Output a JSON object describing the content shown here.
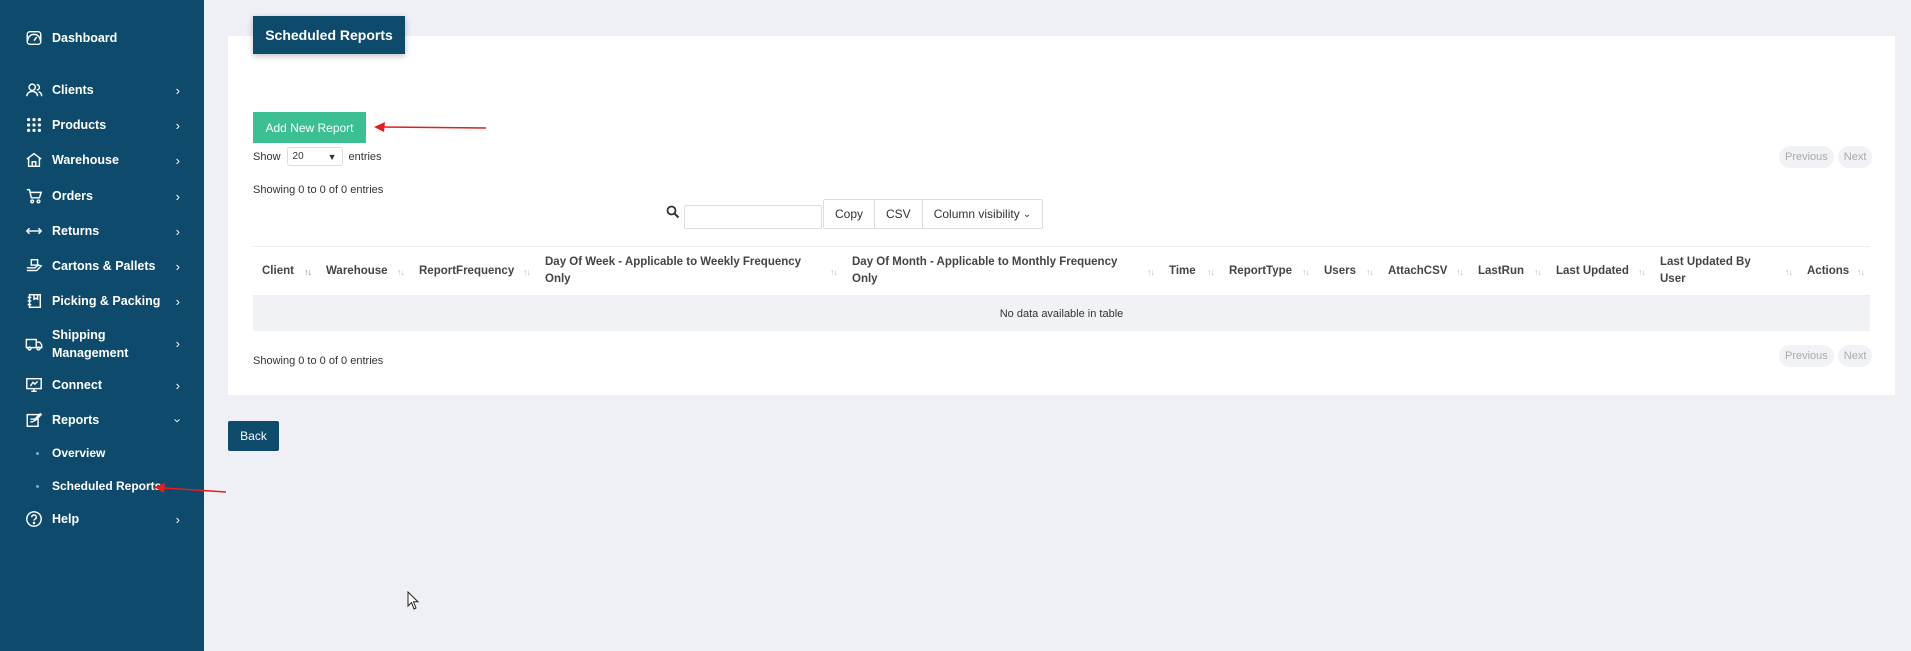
{
  "sidebar": {
    "items": [
      {
        "label": "Dashboard",
        "icon": "dashboard-icon"
      },
      {
        "label": "Clients",
        "icon": "clients-icon"
      },
      {
        "label": "Products",
        "icon": "products-icon"
      },
      {
        "label": "Warehouse",
        "icon": "warehouse-icon"
      },
      {
        "label": "Orders",
        "icon": "orders-icon"
      },
      {
        "label": "Returns",
        "icon": "returns-icon"
      },
      {
        "label": "Cartons & Pallets",
        "icon": "cartons-icon"
      },
      {
        "label": "Picking & Packing",
        "icon": "picking-icon"
      },
      {
        "label": "Shipping",
        "label2": "Management",
        "icon": "shipping-icon"
      },
      {
        "label": "Connect",
        "icon": "connect-icon"
      },
      {
        "label": "Reports",
        "icon": "reports-icon"
      },
      {
        "label": "Help",
        "icon": "help-icon"
      }
    ],
    "reports_sub": [
      {
        "label": "Overview"
      },
      {
        "label": "Scheduled Reports"
      }
    ]
  },
  "main": {
    "title": "Scheduled Reports",
    "add_button": "Add New Report",
    "show_label": "Show",
    "entries_label": "entries",
    "page_length": "20",
    "info_top": "Showing 0 to 0 of 0 entries",
    "info_bottom": "Showing 0 to 0 of 0 entries",
    "pager": {
      "previous": "Previous",
      "next": "Next"
    },
    "buttons": {
      "copy": "Copy",
      "csv": "CSV",
      "colvis": "Column visibility"
    },
    "columns": [
      "Client",
      "Warehouse",
      "ReportFrequency",
      "Day Of Week - Applicable to Weekly Frequency Only",
      "Day Of Month - Applicable to Monthly Frequency Only",
      "Time",
      "ReportType",
      "Users",
      "AttachCSV",
      "LastRun",
      "Last Updated",
      "Last Updated By User",
      "Actions"
    ],
    "empty_message": "No data available in table",
    "back_button": "Back"
  },
  "colors": {
    "sidebar_bg": "#0d4a6b",
    "accent_green": "#3dbf94",
    "annotation_arrow": "#e02020"
  }
}
